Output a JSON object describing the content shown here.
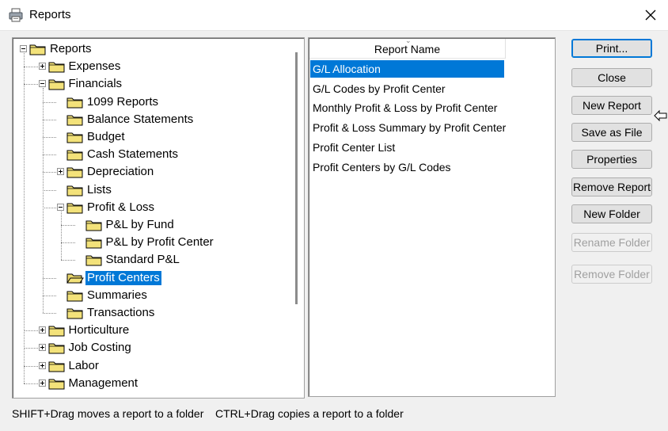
{
  "window": {
    "title": "Reports"
  },
  "tree": {
    "rows": [
      {
        "label": "Reports",
        "expander": "minus"
      },
      {
        "label": "Expenses",
        "expander": "plus"
      },
      {
        "label": "Financials",
        "expander": "minus"
      },
      {
        "label": "1099 Reports"
      },
      {
        "label": "Balance Statements"
      },
      {
        "label": "Budget"
      },
      {
        "label": "Cash Statements"
      },
      {
        "label": "Depreciation",
        "expander": "plus"
      },
      {
        "label": "Lists"
      },
      {
        "label": "Profit & Loss",
        "expander": "minus"
      },
      {
        "label": "P&L by Fund"
      },
      {
        "label": "P&L by Profit Center"
      },
      {
        "label": "Standard P&L"
      },
      {
        "label": "Profit Centers",
        "selected": true,
        "open": true
      },
      {
        "label": "Summaries"
      },
      {
        "label": "Transactions"
      },
      {
        "label": "Horticulture",
        "expander": "plus"
      },
      {
        "label": "Job Costing",
        "expander": "plus"
      },
      {
        "label": "Labor",
        "expander": "plus"
      },
      {
        "label": "Management",
        "expander": "plus"
      }
    ]
  },
  "report_list": {
    "header": "Report Name",
    "items": [
      {
        "label": "G/L Allocation",
        "selected": true
      },
      {
        "label": "G/L Codes by Profit Center"
      },
      {
        "label": "Monthly Profit & Loss by Profit Center"
      },
      {
        "label": "Profit & Loss Summary by Profit Center"
      },
      {
        "label": "Profit Center List"
      },
      {
        "label": "Profit Centers by G/L Codes"
      }
    ]
  },
  "buttons": {
    "print": "Print...",
    "close": "Close",
    "new_report": "New Report",
    "save_as_file": "Save as File",
    "properties": "Properties",
    "remove_report": "Remove Report",
    "new_folder": "New Folder",
    "rename_folder": "Rename Folder",
    "remove_folder": "Remove Folder"
  },
  "status": {
    "shift_hint": "SHIFT+Drag moves a report to a folder",
    "ctrl_hint": "CTRL+Drag copies a report to a folder"
  },
  "colors": {
    "selection": "#0078d7",
    "folder": "#f3e27a"
  }
}
